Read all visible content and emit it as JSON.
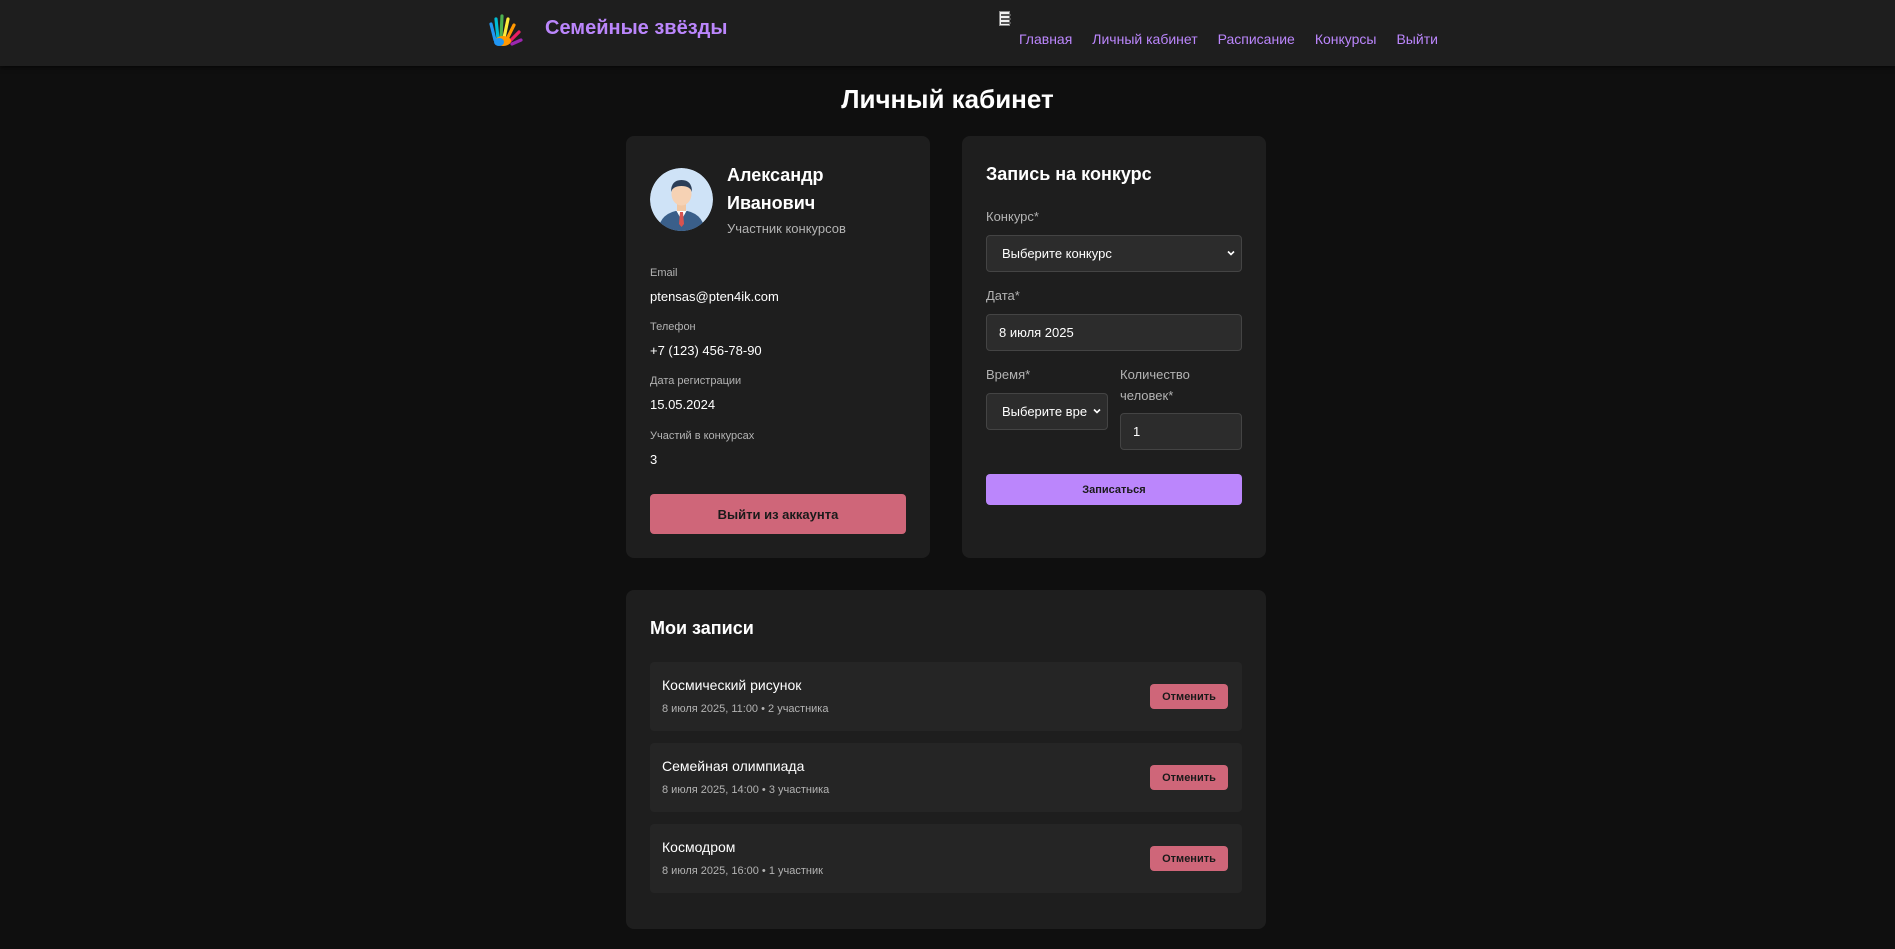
{
  "header": {
    "brand": "Семейные звёзды",
    "logo_icon": "colorful-hands-logo",
    "menu_icon": "menu-icon",
    "nav": [
      {
        "label": "Главная"
      },
      {
        "label": "Личный кабинет"
      },
      {
        "label": "Расписание"
      },
      {
        "label": "Конкурсы"
      },
      {
        "label": "Выйти"
      }
    ]
  },
  "page": {
    "title": "Личный кабинет"
  },
  "profile": {
    "name": "Александр Иванович",
    "role": "Участник конкурсов",
    "avatar_icon": "user-avatar",
    "fields": [
      {
        "label": "Email",
        "value": "ptensas@pten4ik.com"
      },
      {
        "label": "Телефон",
        "value": "+7 (123) 456-78-90"
      },
      {
        "label": "Дата регистрации",
        "value": "15.05.2024"
      },
      {
        "label": "Участий в конкурсах",
        "value": "3"
      }
    ],
    "logout_label": "Выйти из аккаунта"
  },
  "booking": {
    "title": "Запись на конкурс",
    "contest_label": "Конкурс*",
    "contest_value": "Выберите конкурс",
    "date_label": "Дата*",
    "date_value": "8 июля 2025",
    "time_label": "Время*",
    "time_value": "Выберите вре",
    "people_label": "Количество человек*",
    "people_value": "1",
    "submit_label": "Записаться"
  },
  "records": {
    "title": "Мои записи",
    "items": [
      {
        "title": "Космический рисунок",
        "meta": "8 июля 2025, 11:00 • 2 участника",
        "cancel": "Отменить"
      },
      {
        "title": "Семейная олимпиада",
        "meta": "8 июля 2025, 14:00 • 3 участника",
        "cancel": "Отменить"
      },
      {
        "title": "Космодром",
        "meta": "8 июля 2025, 16:00 • 1 участник",
        "cancel": "Отменить"
      }
    ]
  },
  "colors": {
    "accent": "#bb86fc",
    "danger": "#cf6679",
    "background": "#0f0f0f",
    "surface": "#1e1e1e"
  }
}
